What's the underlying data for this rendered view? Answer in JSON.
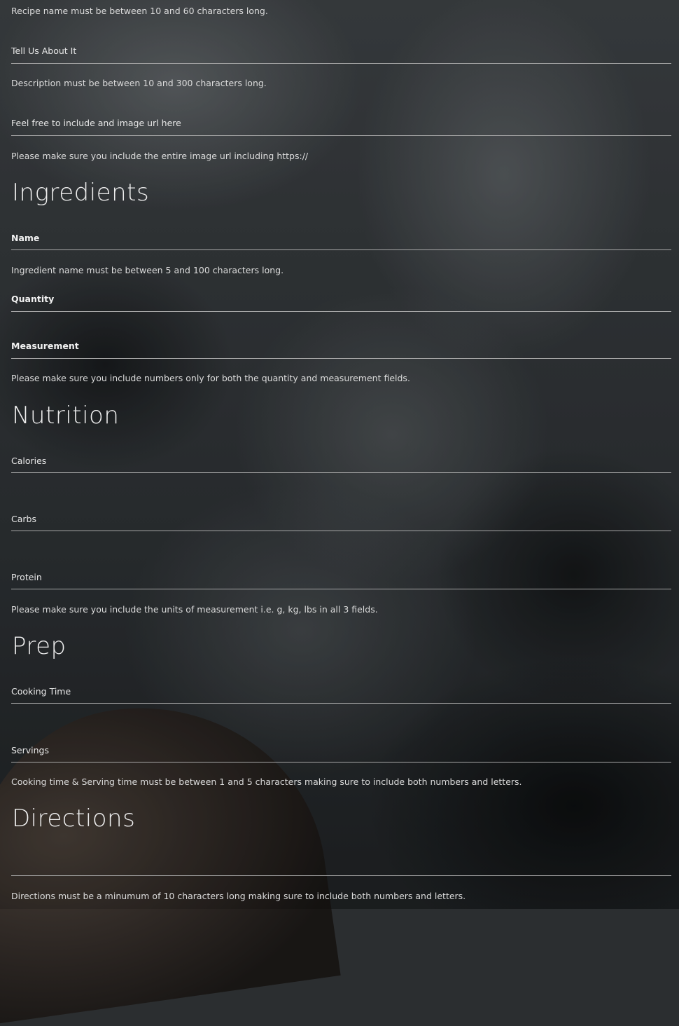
{
  "form": {
    "recipe_name_hint": "Recipe name must be between 10 and 60 characters long.",
    "description_label": "Tell Us About It",
    "description_hint": "Description must be between 10 and 300 characters long.",
    "image_label": "Feel free to include and image url here",
    "image_hint": "Please make sure you include the entire image url including https://"
  },
  "ingredients": {
    "heading": "Ingredients",
    "name_label": "Name",
    "name_hint": "Ingredient name must be between 5 and 100 characters long.",
    "quantity_label": "Quantity",
    "measurement_label": "Measurement",
    "numbers_hint": "Please make sure you include numbers only for both the quantity and measurement fields."
  },
  "nutrition": {
    "heading": "Nutrition",
    "calories_label": "Calories",
    "carbs_label": "Carbs",
    "protein_label": "Protein",
    "units_hint": "Please make sure you include the units of measurement i.e. g, kg, lbs in all 3 fields."
  },
  "prep": {
    "heading": "Prep",
    "cooking_time_label": "Cooking Time",
    "servings_label": "Servings",
    "time_hint": "Cooking time & Serving time must be between 1 and 5 characters making sure to include both numbers and letters."
  },
  "directions": {
    "heading": "Directions",
    "directions_hint": "Directions must be a minumum of 10 characters long making sure to include both numbers and letters."
  }
}
